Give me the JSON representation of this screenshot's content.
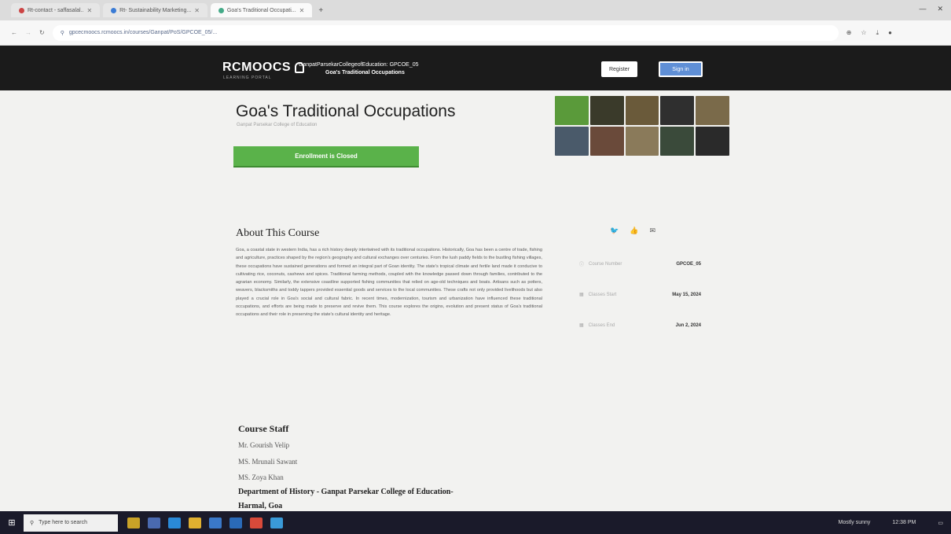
{
  "browser": {
    "tabs": [
      {
        "label": "Rt-contact - saffasalal.."
      },
      {
        "label": "Rt- Sustainability Marketing..."
      },
      {
        "label": "Goa's Traditional Occupati..."
      }
    ],
    "url": "gpcecmoocs.rcmoocs.in/courses/Ganpat/PoS/GPCOE_05/..."
  },
  "header": {
    "logo": "RCMOOCS",
    "logo_sub": "LEARNING PORTAL",
    "course_code_line": "GanpatParsekarCollegeofEducation: GPCOE_05",
    "course_name_line": "Goa's Traditional Occupations",
    "register_label": "Register",
    "signin_label": "Sign in"
  },
  "course": {
    "title": "Goa's Traditional Occupations",
    "org": "Ganpat Parsekar College of Education",
    "enroll_label": "Enrollment is Closed"
  },
  "about": {
    "heading": "About This Course",
    "body": "Goa, a coastal state in western India, has a rich history deeply intertwined with its traditional occupations. Historically, Goa has been a centre of trade, fishing and agriculture, practices shaped by the region's geography and cultural exchanges over centuries. From the lush paddy fields to the bustling fishing villages, these occupations have sustained generations and formed an integral part of Goan identity. The state's tropical climate and fertile land made it conducive to cultivating rice, coconuts, cashews and spices. Traditional farming methods, coupled with the knowledge passed down through families, contributed to the agrarian economy. Similarly, the extensive coastline supported fishing communities that relied on age-old techniques and boats. Artisans such as potters, weavers, blacksmiths and toddy tappers provided essential goods and services to the local communities. These crafts not only provided livelihoods but also played a crucial role in Goa's social and cultural fabric. In recent times, modernization, tourism and urbanization have influenced these traditional occupations, and efforts are being made to preserve and revive them. This course explores the origins, evolution and present status of Goa's traditional occupations and their role in preserving the state's cultural identity and heritage."
  },
  "staff": {
    "heading": "Course Staff",
    "members": [
      "Mr. Gourish Velip",
      "MS. Mrunali Sawant",
      "MS. Zoya Khan"
    ],
    "department": "Department of History - Ganpat Parsekar College of Education-",
    "location": "Harmal, Goa"
  },
  "sidebar": {
    "course_number_label": "Course Number",
    "course_number": "GPCOE_05",
    "classes_start_label": "Classes Start",
    "classes_start": "May 15, 2024",
    "classes_end_label": "Classes End",
    "classes_end": "Jun 2, 2024"
  },
  "taskbar": {
    "search_placeholder": "Type here to search",
    "weather": "Mostly sunny",
    "clock": "12:38 PM"
  },
  "colors": {
    "header_bg": "#1b1b1b",
    "enroll_green": "#5ab24a",
    "signin_blue": "#5f8fd6"
  }
}
